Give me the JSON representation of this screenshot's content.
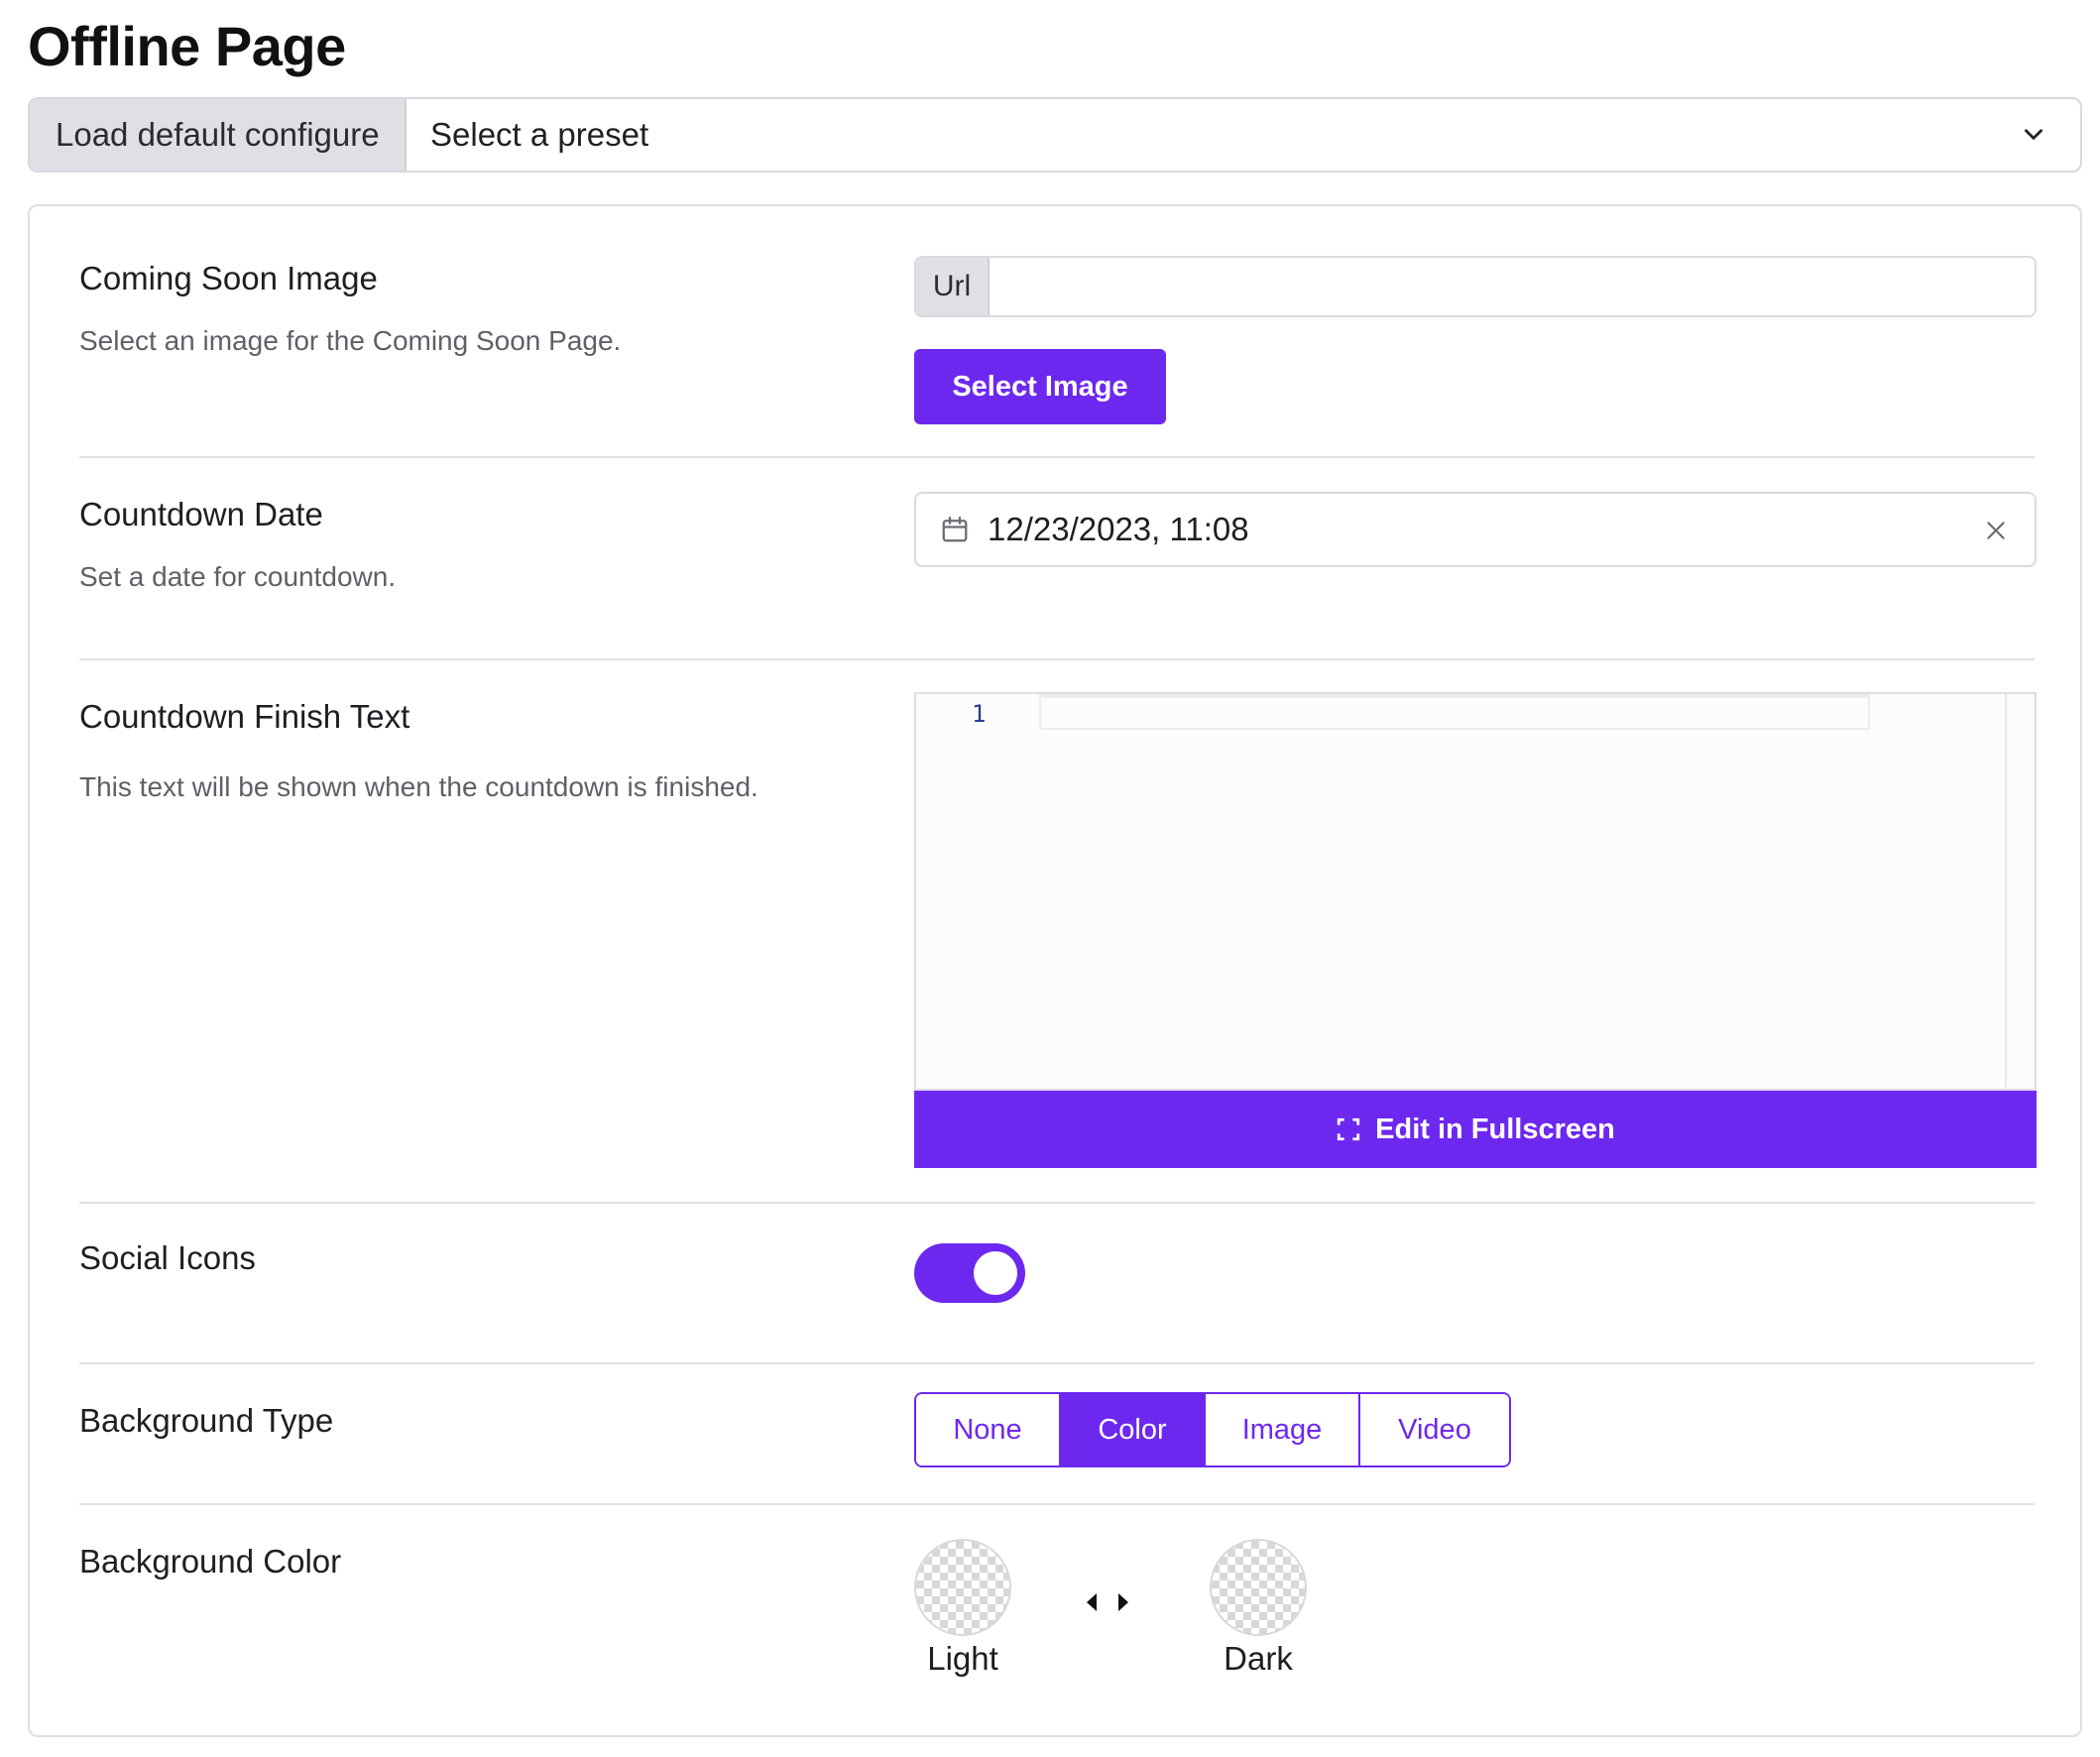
{
  "page": {
    "title": "Offline Page"
  },
  "preset": {
    "load_default_label": "Load default configure",
    "select_placeholder": "Select a preset"
  },
  "settings": {
    "coming_soon_image": {
      "title": "Coming Soon Image",
      "description": "Select an image for the Coming Soon Page.",
      "url_addon": "Url",
      "url_value": "",
      "select_button": "Select Image"
    },
    "countdown_date": {
      "title": "Countdown Date",
      "description": "Set a date for countdown.",
      "value": "12/23/2023, 11:08",
      "icon": "calendar-icon",
      "clear_icon": "close-icon"
    },
    "countdown_finish_text": {
      "title": "Countdown Finish Text",
      "description": "This text will be shown when the countdown is finished.",
      "line_number": "1",
      "fullscreen_button": "Edit in Fullscreen",
      "fullscreen_icon": "fullscreen-icon"
    },
    "social_icons": {
      "title": "Social Icons",
      "enabled": true
    },
    "background_type": {
      "title": "Background Type",
      "options": [
        "None",
        "Color",
        "Image",
        "Video"
      ],
      "selected": "Color"
    },
    "background_color": {
      "title": "Background Color",
      "light_label": "Light",
      "dark_label": "Dark"
    }
  },
  "colors": {
    "accent": "#6d28f0",
    "addon_bg": "#e2dee6",
    "border": "#dcdae0"
  }
}
